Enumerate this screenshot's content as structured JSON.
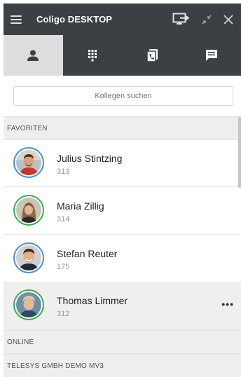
{
  "app": {
    "title": "Coligo DESKTOP"
  },
  "tabs": [
    {
      "icon": "person-icon",
      "active": true
    },
    {
      "icon": "dialpad-icon",
      "active": false
    },
    {
      "icon": "call-transfer-icon",
      "active": false
    },
    {
      "icon": "chat-icon",
      "active": false
    }
  ],
  "search": {
    "placeholder": "Kollegen suchen",
    "value": ""
  },
  "sections": {
    "favorites": "FAVORITEN",
    "online": "ONLINE",
    "telesys": "TELESYS GMBH DEMO MV3"
  },
  "contacts": [
    {
      "name": "Julius Stintzing",
      "ext": "313",
      "status_color": "#4a90c8"
    },
    {
      "name": "Maria Zillig",
      "ext": "314",
      "status_color": "#3caa4e"
    },
    {
      "name": "Stefan Reuter",
      "ext": "175",
      "status_color": "#4a90c8"
    },
    {
      "name": "Thomas Limmer",
      "ext": "312",
      "status_color": "#3caa4e",
      "more": "•••"
    }
  ],
  "colors": {
    "titlebar": "#3c4045",
    "active_tab": "#dddddd",
    "available": "#3caa4e",
    "busy": "#4a90c8"
  }
}
